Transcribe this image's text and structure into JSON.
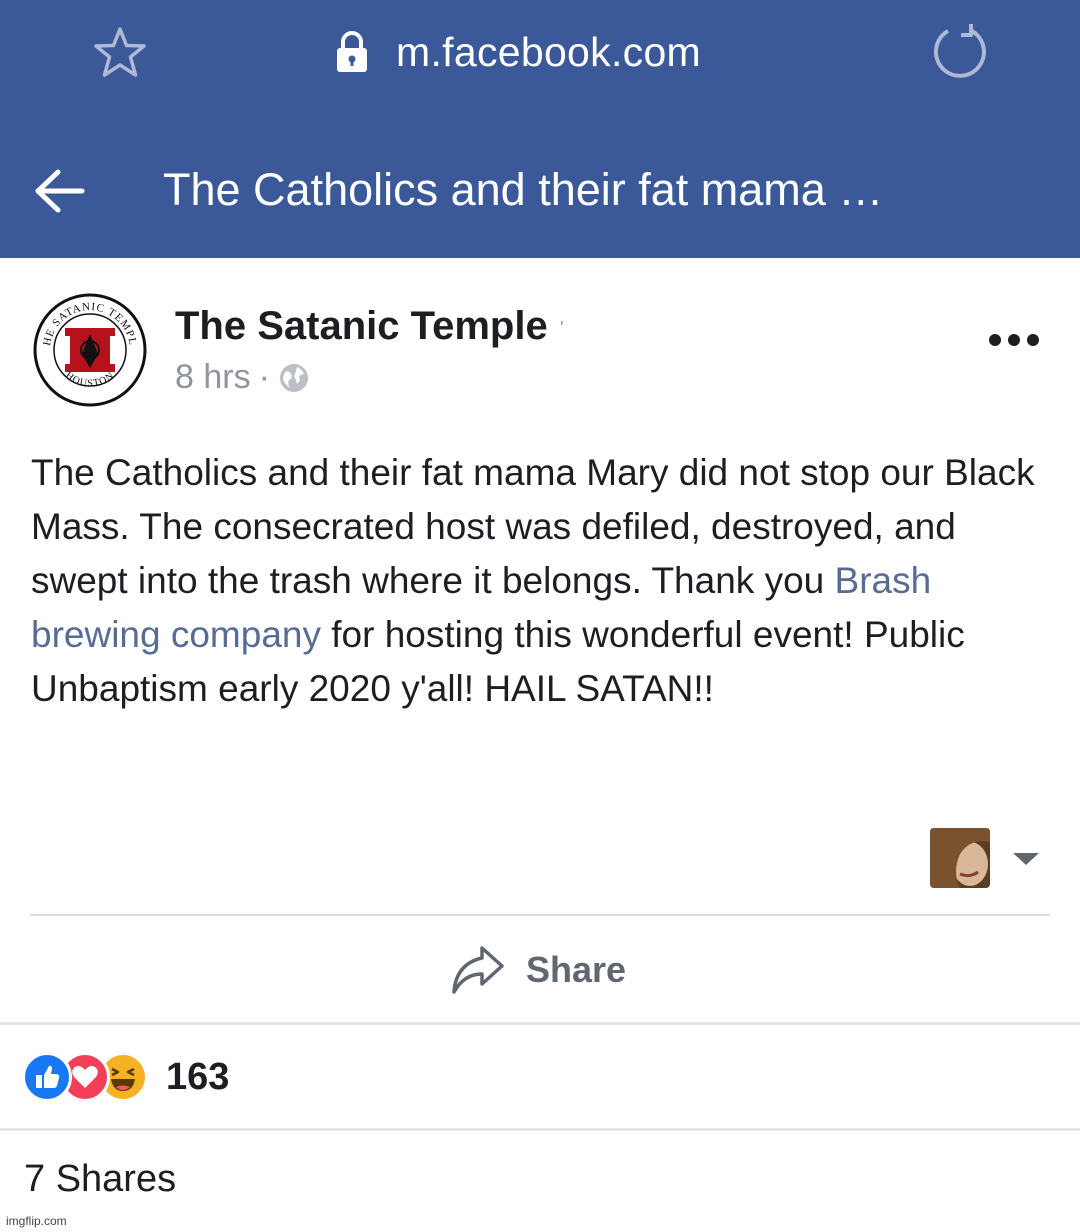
{
  "browser": {
    "url": "m.facebook.com",
    "icons": {
      "bookmark": "star-icon",
      "secure": "lock-icon",
      "refresh": "reload-icon"
    }
  },
  "header": {
    "title": "The Catholics and their fat mama …",
    "back_icon": "arrow-left-icon",
    "background_color": "#3b5998"
  },
  "post": {
    "author": "The Satanic Temple",
    "author_mark": "'",
    "timestamp": "8 hrs",
    "separator": "·",
    "privacy_icon": "globe-icon",
    "avatar": {
      "top_text": "THE SATANIC TEMPLE",
      "bottom_text": "HOUSTON",
      "accent_color": "#b5121b"
    },
    "text_before_link": "The Catholics and their fat mama Mary did not stop our Black Mass. The consecrated host was defiled, destroyed, and swept into the trash where it belongs. Thank you ",
    "link_text": "Brash brewing company",
    "text_after_link": " for hosting this wonderful event! Public Unbaptism early 2020 y'all! HAIL SATAN!!",
    "link_color": "#576b95"
  },
  "actions": {
    "share_label": "Share",
    "share_icon": "share-arrow-icon",
    "more_icon": "more-dots-icon",
    "caret_icon": "caret-down-icon"
  },
  "reactions": {
    "types": [
      "like",
      "love",
      "haha"
    ],
    "count": "163"
  },
  "shares": {
    "label": "7 Shares"
  },
  "watermark": "imgflip.com"
}
